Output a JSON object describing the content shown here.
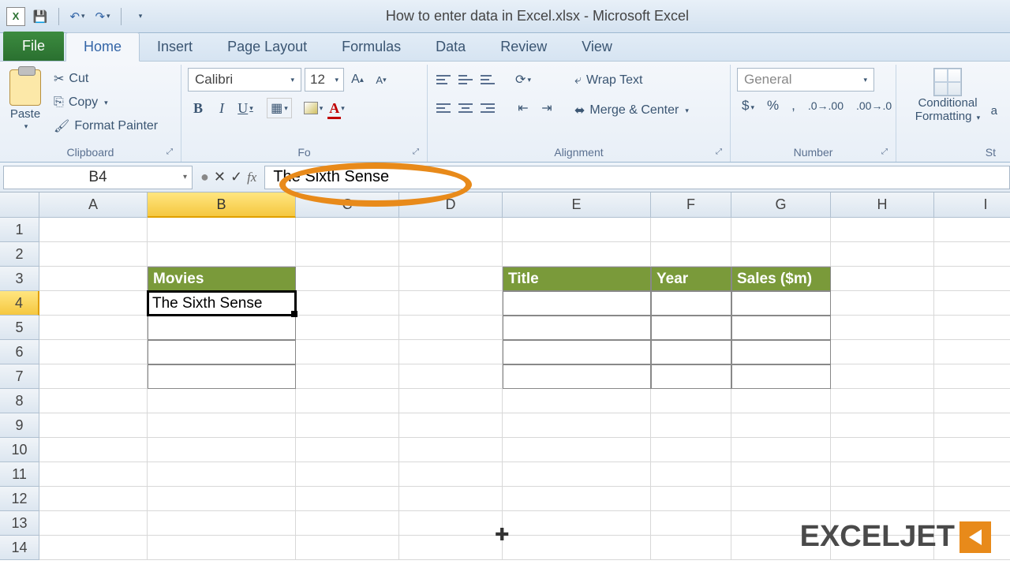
{
  "window": {
    "title": "How to enter data in Excel.xlsx - Microsoft Excel"
  },
  "tabs": {
    "file": "File",
    "home": "Home",
    "insert": "Insert",
    "page_layout": "Page Layout",
    "formulas": "Formulas",
    "data": "Data",
    "review": "Review",
    "view": "View"
  },
  "ribbon": {
    "clipboard": {
      "label": "Clipboard",
      "paste": "Paste",
      "cut": "Cut",
      "copy": "Copy",
      "format_painter": "Format Painter"
    },
    "font": {
      "label": "Font",
      "name": "Calibri",
      "size": "12"
    },
    "alignment": {
      "label": "Alignment",
      "wrap": "Wrap Text",
      "merge": "Merge & Center"
    },
    "number": {
      "label": "Number",
      "format": "General"
    },
    "styles": {
      "cond": "Conditional",
      "fmt": "Formatting",
      "a": "a"
    }
  },
  "namebox": "B4",
  "formula": "The Sixth Sense",
  "columns": [
    {
      "letter": "A",
      "w": 137
    },
    {
      "letter": "B",
      "w": 188
    },
    {
      "letter": "C",
      "w": 131
    },
    {
      "letter": "D",
      "w": 131
    },
    {
      "letter": "E",
      "w": 188
    },
    {
      "letter": "F",
      "w": 102
    },
    {
      "letter": "G",
      "w": 126
    },
    {
      "letter": "H",
      "w": 131
    },
    {
      "letter": "I",
      "w": 131
    }
  ],
  "rows": [
    1,
    2,
    3,
    4,
    5,
    6,
    7,
    8,
    9,
    10,
    11,
    12,
    13,
    14
  ],
  "cells": {
    "B3": "Movies",
    "B4": "The Sixth Sense",
    "E3": "Title",
    "F3": "Year",
    "G3": "Sales ($m)"
  },
  "active_cell": "B4",
  "watermark": "EXCELJET"
}
